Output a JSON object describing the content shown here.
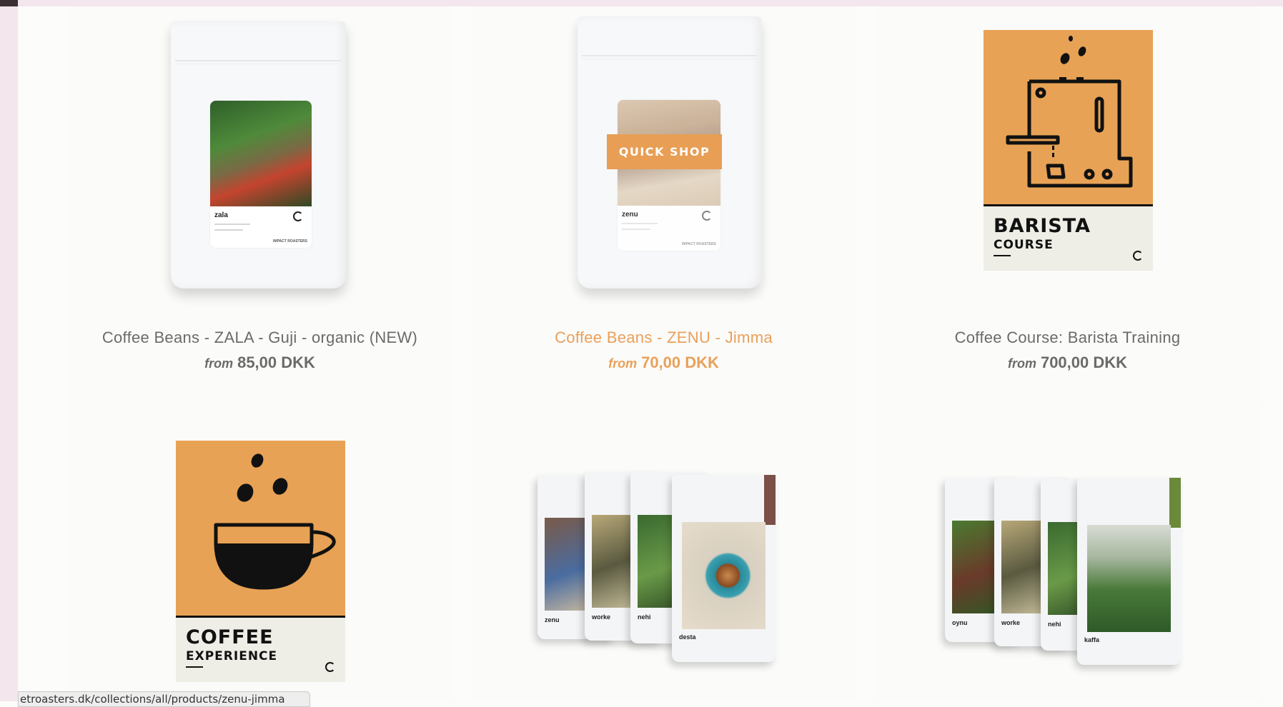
{
  "products": [
    {
      "title": "Coffee Beans - ZALA - Guji - organic (NEW)",
      "from_label": "from",
      "price": "85,00 DKK",
      "label_name": "zala",
      "label_brand": "IMPACT ROASTERS"
    },
    {
      "title": "Coffee Beans - ZENU - Jimma",
      "from_label": "from",
      "price": "70,00 DKK",
      "label_name": "zenu",
      "label_brand": "IMPACT ROASTERS",
      "quick_shop": "QUICK SHOP"
    },
    {
      "title": "Coffee Course: Barista Training",
      "from_label": "from",
      "price": "700,00 DKK",
      "poster_line1": "BARISTA",
      "poster_line2": "COURSE"
    },
    {
      "poster_line1": "COFFEE",
      "poster_line2": "EXPERIENCE"
    },
    {
      "pouches": [
        "zenu",
        "worke",
        "nehi",
        "desta"
      ]
    },
    {
      "pouches": [
        "oynu",
        "worke",
        "nehi",
        "kaffa"
      ]
    }
  ],
  "status_url": "etroasters.dk/collections/all/products/zenu-jimma",
  "colors": {
    "accent": "#e89e54",
    "text": "#6b6b6b",
    "poster": "#e8a255"
  }
}
